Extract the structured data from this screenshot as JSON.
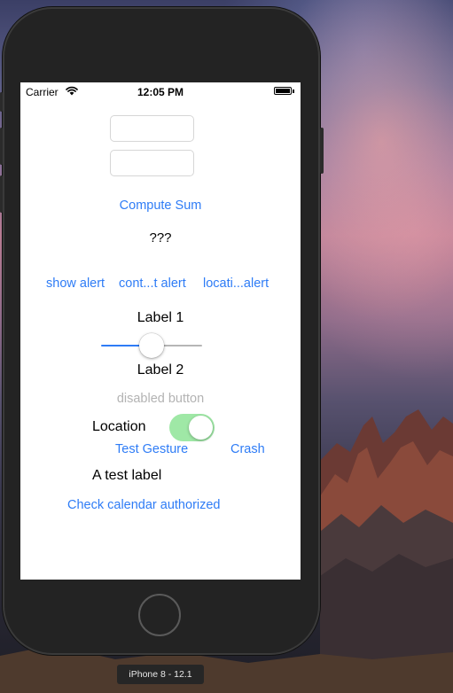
{
  "status_bar": {
    "carrier": "Carrier",
    "wifi_icon": "wifi-icon",
    "time": "12:05 PM",
    "battery_icon": "battery-icon",
    "battery_level": 1.0
  },
  "app": {
    "text_field_1": {
      "value": "",
      "placeholder": ""
    },
    "text_field_2": {
      "value": "",
      "placeholder": ""
    },
    "compute_sum_label": "Compute Sum",
    "result_label": "???",
    "alert_buttons": [
      "show alert",
      "cont...t alert",
      "locati...alert"
    ],
    "label_1": "Label 1",
    "slider_value": 0.5,
    "slider_colors": {
      "min_track": "#2e7cf6",
      "max_track": "#b6b6b6"
    },
    "label_2": "Label 2",
    "disabled_button_label": "disabled button",
    "location_label": "Location",
    "location_switch_on": true,
    "switch_on_color": "#9fe8a6",
    "test_gesture_label": "Test Gesture",
    "crash_label": "Crash",
    "test_label": "A test label",
    "check_calendar_label": "Check calendar authorized",
    "accent_color": "#2e7cf6"
  },
  "device": {
    "caption": "iPhone 8 - 12.1",
    "home_button_icon": "home-button"
  }
}
